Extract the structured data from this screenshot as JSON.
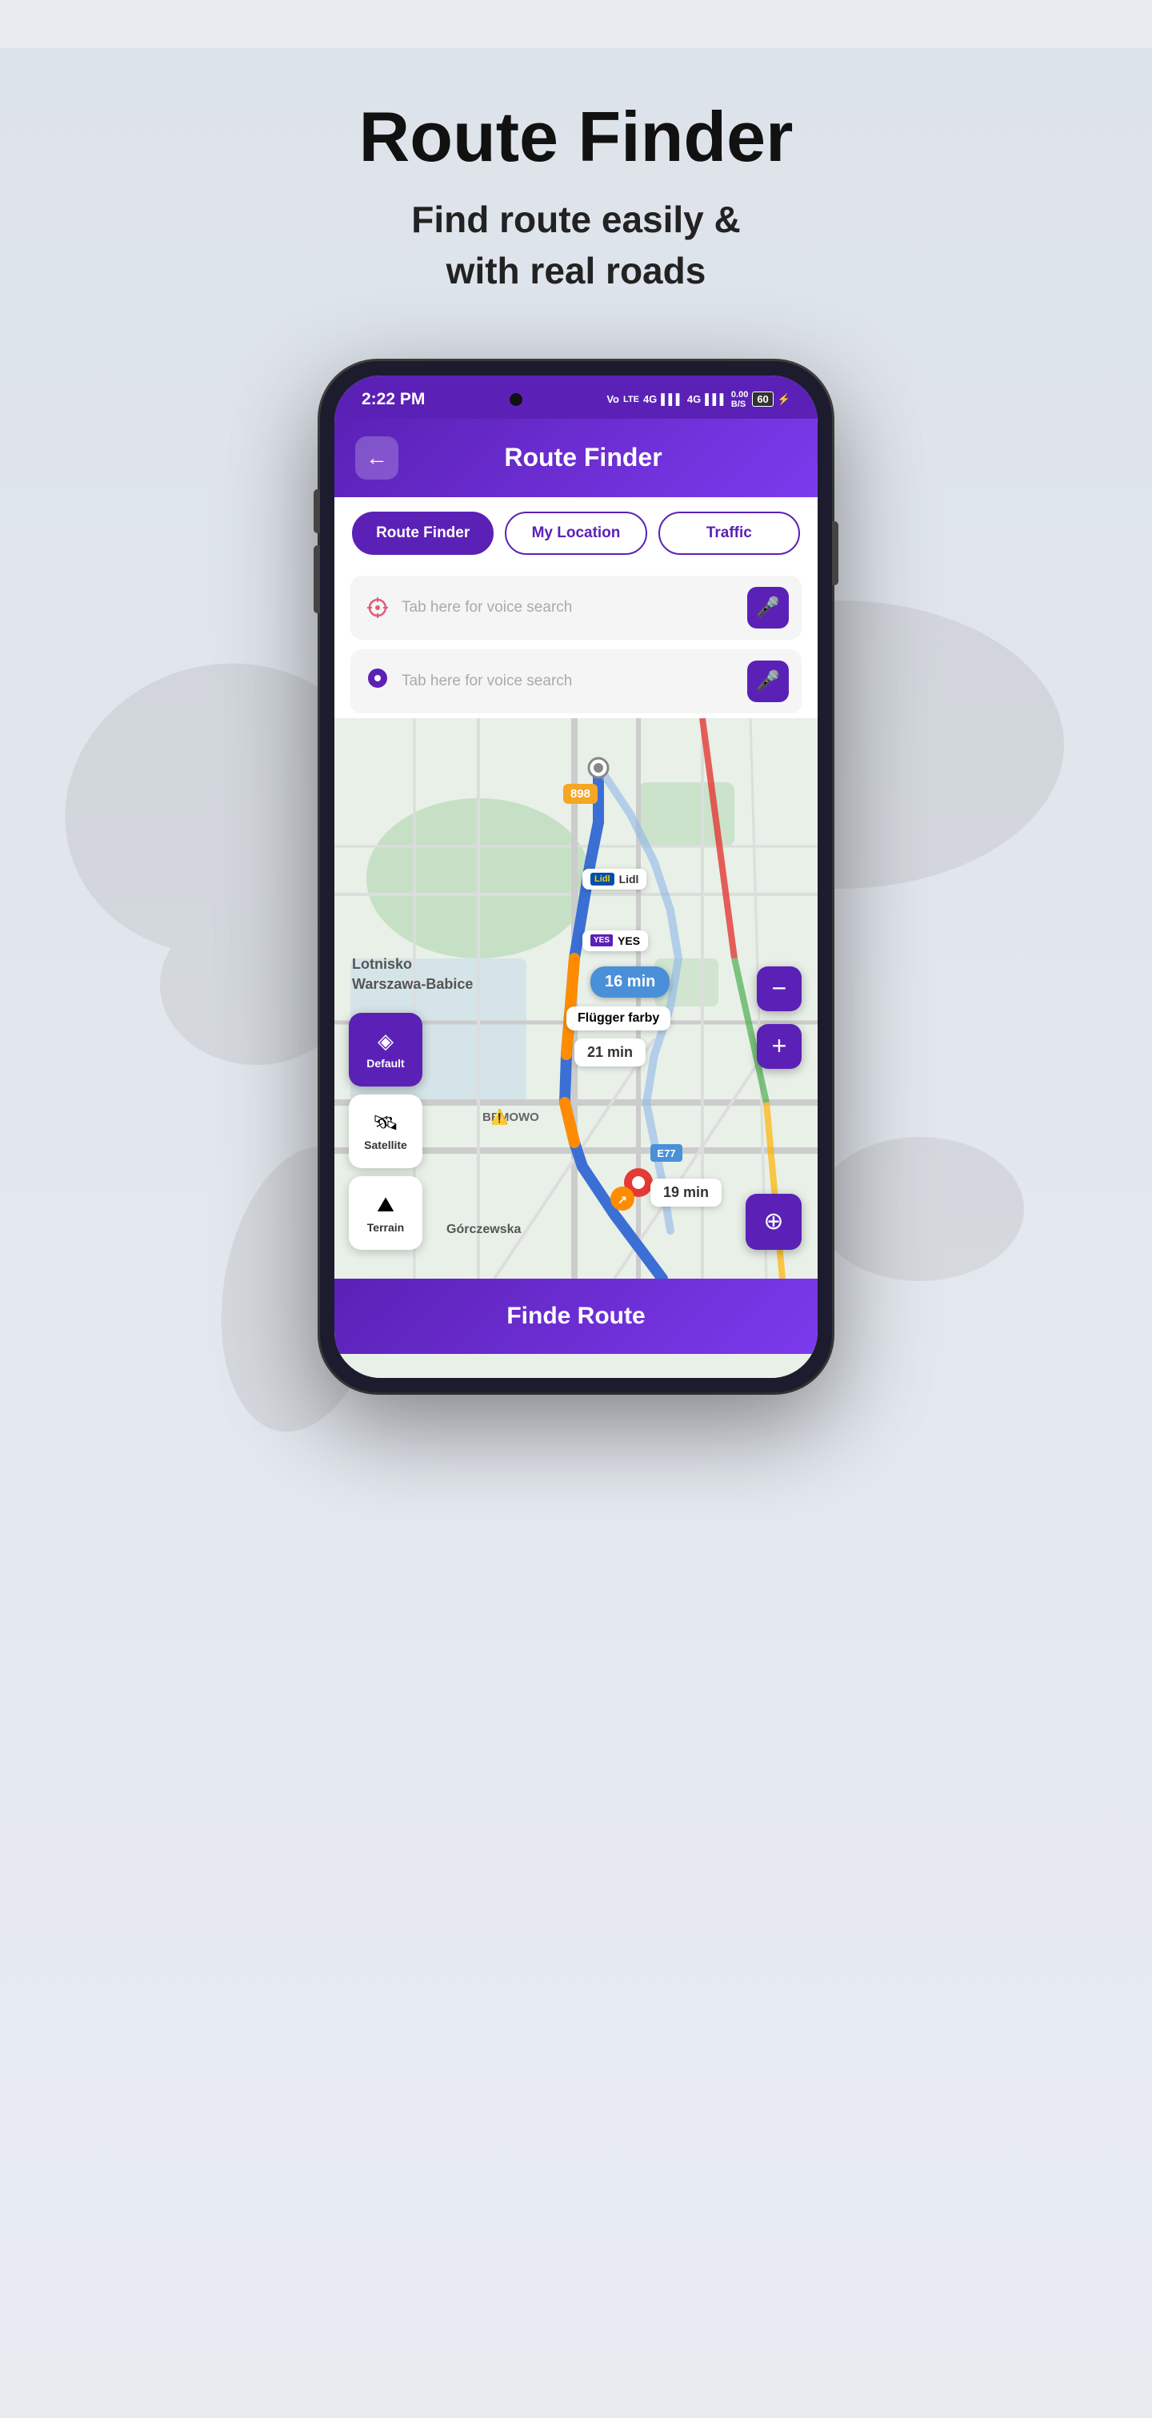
{
  "page": {
    "title": "Route Finder",
    "subtitle": "Find route easily &\nwith real roads"
  },
  "app": {
    "header_title": "Route Finder",
    "back_button": "←",
    "status_time": "2:22 PM",
    "status_icons": "Vo 4G 4G 0.00 60"
  },
  "tabs": [
    {
      "label": "Route Finder",
      "active": true
    },
    {
      "label": "My Location",
      "active": false
    },
    {
      "label": "Traffic",
      "active": false
    }
  ],
  "search": {
    "placeholder1": "Tab here for voice search",
    "placeholder2": "Tab here for voice search"
  },
  "map": {
    "airport_label": "Lotnisko\nWarsawa-Babice",
    "bemowo_label": "BEMOWO",
    "gorczewska_label": "Górczewska",
    "lidl_label": "Lidl",
    "yes_label": "YES",
    "flugger_label": "Flügger farby",
    "route_time1": "16 min",
    "route_time2": "21 min",
    "route_time3": "19 min",
    "road_898": "898",
    "road_e77": "E77"
  },
  "map_types": [
    {
      "label": "Default",
      "icon": "◈",
      "active": true
    },
    {
      "label": "Satellite",
      "icon": "🛰",
      "active": false
    },
    {
      "label": "Terrain",
      "icon": "⛰",
      "active": false
    }
  ],
  "bottom_button": "Finde Route",
  "colors": {
    "primary": "#5b21b6",
    "route_blue": "#3b6fd4",
    "route_highlight": "#4a90d9"
  }
}
